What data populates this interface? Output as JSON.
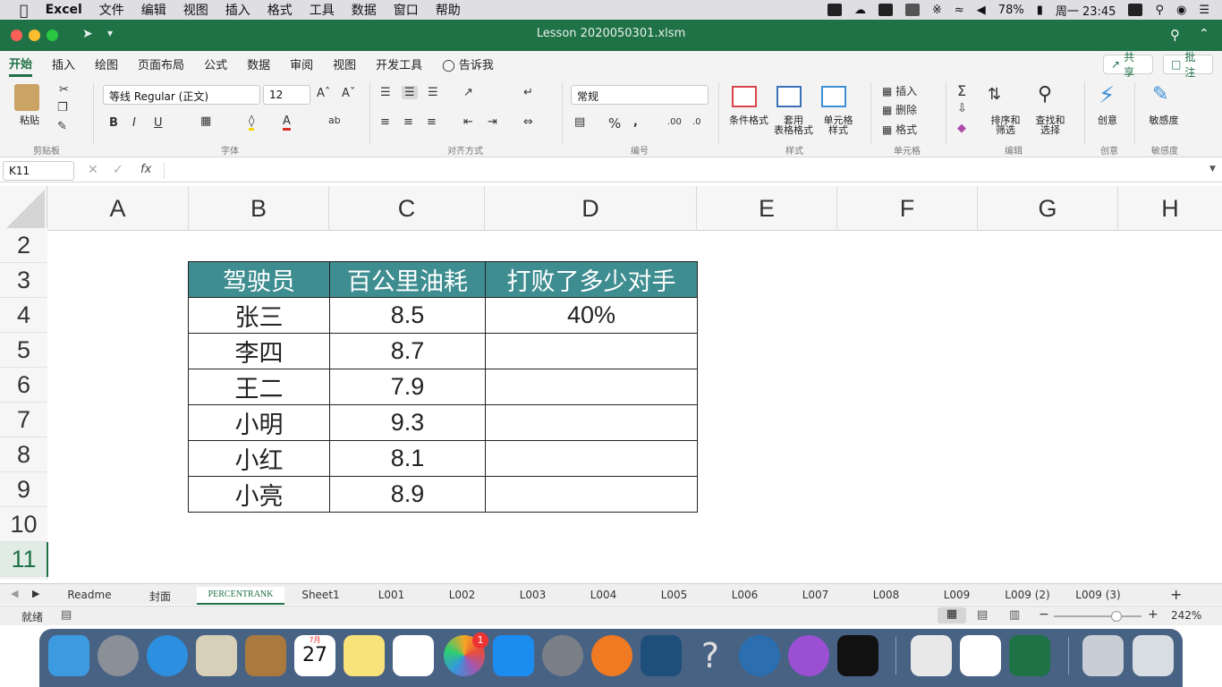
{
  "menubar": {
    "app": "Excel",
    "items": [
      "文件",
      "编辑",
      "视图",
      "插入",
      "格式",
      "工具",
      "数据",
      "窗口",
      "帮助"
    ],
    "battery": "78%",
    "clock": "周一 23:45"
  },
  "window": {
    "title": "Lesson 2020050301.xlsm"
  },
  "ribbon_tabs": [
    "开始",
    "插入",
    "绘图",
    "页面布局",
    "公式",
    "数据",
    "审阅",
    "视图",
    "开发工具",
    "告诉我"
  ],
  "share_label": "共享",
  "comment_label": "批注",
  "ribbon": {
    "paste": "粘贴",
    "font_name": "等线 Regular (正文)",
    "font_size": "12",
    "number_format": "常规",
    "cond_format": "条件格式",
    "table_format_1": "套用",
    "table_format_2": "表格格式",
    "cell_style_1": "单元格",
    "cell_style_2": "样式",
    "insert": "插入",
    "delete": "删除",
    "format": "格式",
    "sort_1": "排序和",
    "sort_2": "筛选",
    "find_1": "查找和",
    "find_2": "选择",
    "ideas": "创意",
    "sensitivity": "敏感度",
    "groups": [
      "剪贴板",
      "字体",
      "对齐方式",
      "编号",
      "样式",
      "单元格",
      "编辑",
      "创意",
      "敏感度"
    ]
  },
  "namebox": "K11",
  "fx": "fx",
  "columns": [
    "A",
    "B",
    "C",
    "D",
    "E",
    "F",
    "G",
    "H"
  ],
  "rows": [
    "2",
    "3",
    "4",
    "5",
    "6",
    "7",
    "8",
    "9",
    "10",
    "11"
  ],
  "table": {
    "headers": [
      "驾驶员",
      "百公里油耗",
      "打败了多少对手"
    ],
    "rows": [
      [
        "张三",
        "8.5",
        "40%"
      ],
      [
        "李四",
        "8.7",
        ""
      ],
      [
        "王二",
        "7.9",
        ""
      ],
      [
        "小明",
        "9.3",
        ""
      ],
      [
        "小红",
        "8.1",
        ""
      ],
      [
        "小亮",
        "8.9",
        ""
      ]
    ]
  },
  "sheets": [
    "Readme",
    "封面",
    "PERCENTRANK",
    "Sheet1",
    "L001",
    "L002",
    "L003",
    "L004",
    "L005",
    "L006",
    "L007",
    "L008",
    "L009",
    "L009 (2)",
    "L009 (3)"
  ],
  "status": {
    "ready": "就绪",
    "zoom": "242%"
  },
  "dock": {
    "calendar_month": "7月",
    "calendar_day": "27",
    "photos_badge": "1"
  },
  "colors": {
    "excel_green": "#1f7146",
    "header_teal": "#3e8d90"
  }
}
